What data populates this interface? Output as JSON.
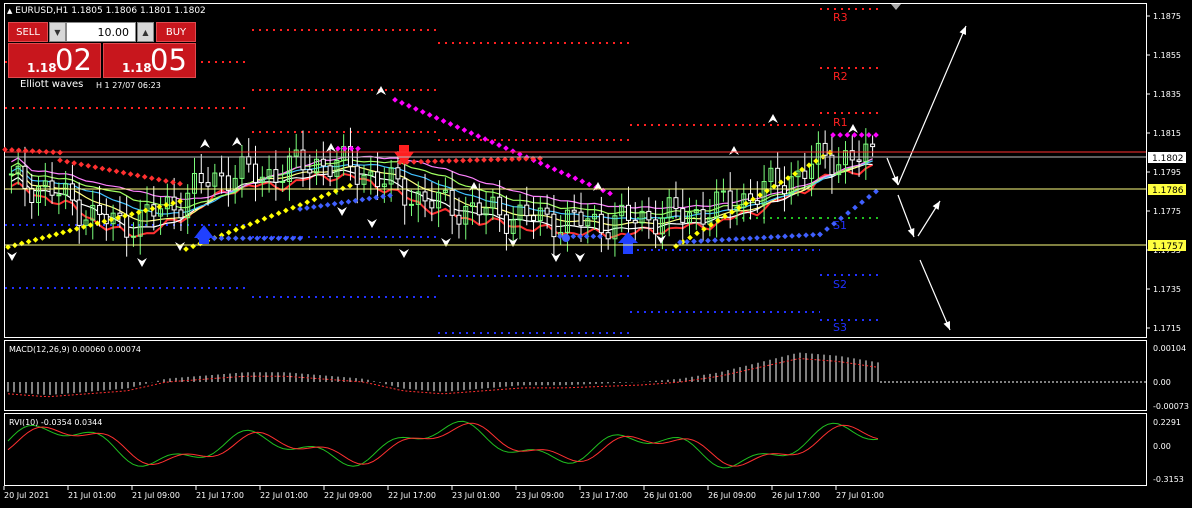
{
  "header": {
    "title": "EURUSD,H1  1.1805 1.1806 1.1801 1.1802"
  },
  "trade_panel": {
    "sell_label": "SELL",
    "buy_label": "BUY",
    "lot_value": "10.00",
    "bid_small": "1.18",
    "bid_big": "02",
    "ask_small": "1.18",
    "ask_big": "05",
    "spin_down": "▼",
    "spin_up": "▲"
  },
  "indicator_label": "Elliott waves",
  "indicator_time": "H 1 27/07 06:23",
  "colors": {
    "background": "#000000",
    "panel_border": "#ffffff",
    "bull_candle": "#7cff7c",
    "pivot_resist": "#ff2020",
    "pivot_support": "#2030ff",
    "magenta_dots": "#ff00ff",
    "yellow_dots": "#ffff00",
    "blue_dots": "#4060ff",
    "price_line": "#ff3030",
    "yellow_level": "#ffff80",
    "macd_hist": "#ffffff",
    "macd_signal": "#ff3030",
    "rvi_main": "#20c020",
    "rvi_signal": "#ff3030"
  },
  "chart_data": [
    {
      "type": "candlestick",
      "title": "EURUSD,H1",
      "ylim": [
        1.1705,
        1.1885
      ],
      "yticks": [
        "1.1875",
        "1.1855",
        "1.1835",
        "1.1815",
        "1.1795",
        "1.1775",
        "1.1755",
        "1.1735",
        "1.1715"
      ],
      "current_price": "1.1802",
      "level_labels": [
        "1.1786",
        "1.1757"
      ],
      "levels": [
        1.1786,
        1.1757
      ],
      "pivot_labels": [
        "R3",
        "R2",
        "R1",
        "S1",
        "S2",
        "S3"
      ],
      "x_labels": [
        "20 Jul 2021",
        "21 Jul 01:00",
        "21 Jul 09:00",
        "21 Jul 17:00",
        "22 Jul 01:00",
        "22 Jul 09:00",
        "22 Jul 17:00",
        "23 Jul 01:00",
        "23 Jul 09:00",
        "23 Jul 17:00",
        "26 Jul 01:00",
        "26 Jul 09:00",
        "26 Jul 17:00",
        "27 Jul 01:00"
      ],
      "closes_approx": [
        1.179,
        1.1788,
        1.1781,
        1.1772,
        1.1768,
        1.1773,
        1.178,
        1.179,
        1.1795,
        1.1793,
        1.1797,
        1.18,
        1.1798,
        1.1793,
        1.1786,
        1.178,
        1.1777,
        1.1775,
        1.1773,
        1.1771,
        1.177,
        1.1769,
        1.177,
        1.1772,
        1.1773,
        1.1775,
        1.178,
        1.1785,
        1.1792,
        1.18,
        1.1803,
        1.1802
      ]
    },
    {
      "type": "bar",
      "title": "MACD(12,26,9) 0.00060 0.00074",
      "yticks": [
        "0.00104",
        "0.00",
        "-0.00073"
      ],
      "ylim": [
        -0.00073,
        0.00104
      ],
      "values_approx": [
        -0.0003,
        -0.0004,
        -0.0003,
        -0.0002,
        0.0001,
        0.0002,
        0.0003,
        0.0003,
        0.0002,
        0.0001,
        -0.0002,
        -0.0003,
        -0.0002,
        -0.0001,
        -0.0001,
        -5e-05,
        0.0,
        0.0001,
        0.0003,
        0.0006,
        0.0009,
        0.0008,
        0.0006
      ]
    },
    {
      "type": "line",
      "title": "RVI(10) -0.0354 0.0344",
      "yticks": [
        "0.2291",
        "0.00",
        "-0.3153"
      ],
      "ylim": [
        -0.3153,
        0.2291
      ]
    }
  ]
}
